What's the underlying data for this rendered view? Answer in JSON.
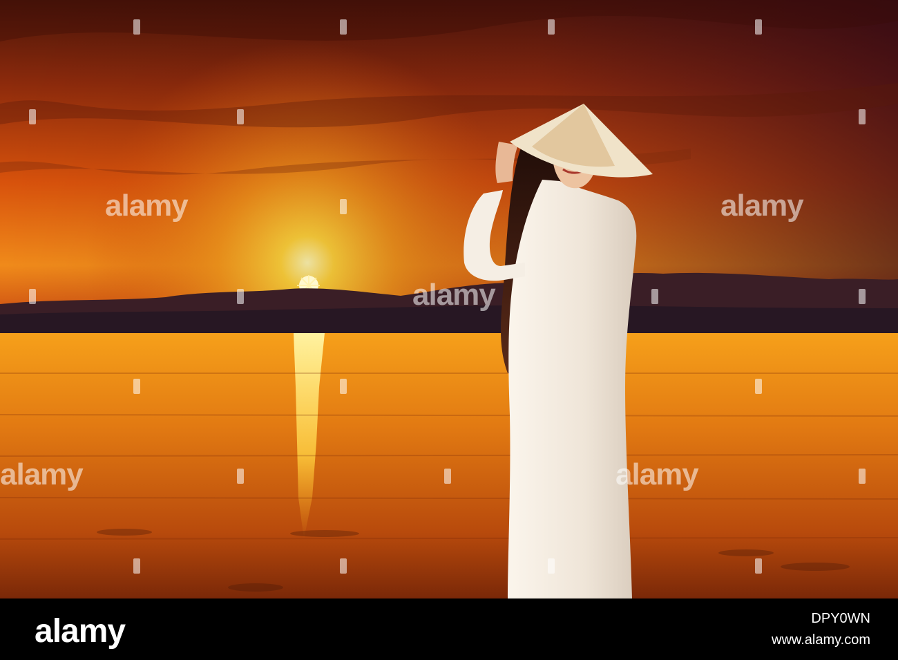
{
  "watermark": {
    "text": "alamy",
    "color": "#ffffff"
  },
  "footer": {
    "logo": "alamy",
    "image_id": "DPY0WN",
    "url": "www.alamy.com"
  },
  "scene": {
    "sky_top": "#5a1a0c",
    "sky_mid": "#c2400d",
    "sun_glow": "#ffd23a",
    "water": "#e27a12",
    "mountains": "#3a1e26",
    "dress": "#f3ece3",
    "hair": "#2a120c",
    "hat": "#f0e3c9"
  }
}
